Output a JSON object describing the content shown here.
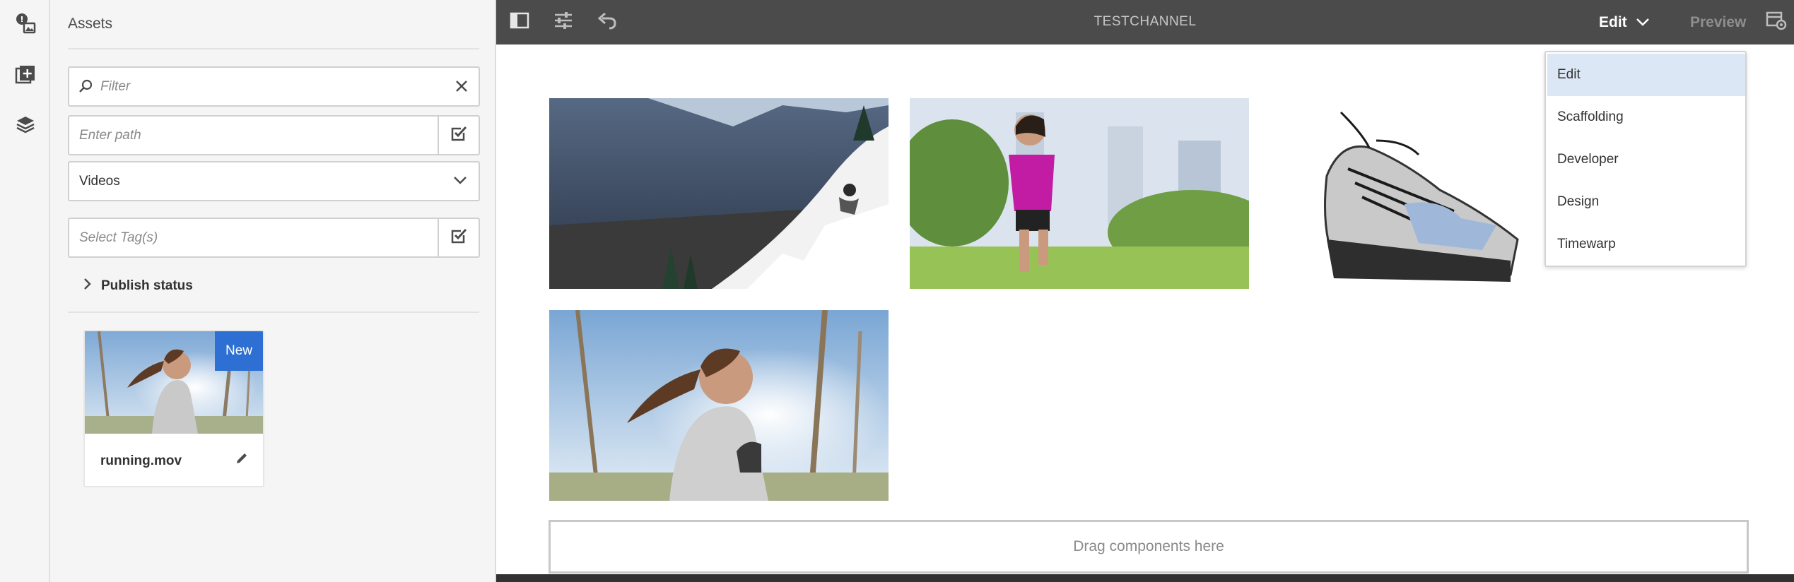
{
  "rail": {
    "items": [
      {
        "icon": "asset-finder-icon"
      },
      {
        "icon": "components-icon"
      },
      {
        "icon": "content-tree-icon"
      }
    ]
  },
  "panel": {
    "title": "Assets",
    "filter": {
      "placeholder": "Filter"
    },
    "path": {
      "placeholder": "Enter path"
    },
    "type_select": {
      "value": "Videos"
    },
    "tags": {
      "placeholder": "Select Tag(s)"
    },
    "publish_status": {
      "label": "Publish status"
    },
    "asset_card": {
      "badge": "New",
      "name": "running.mov"
    }
  },
  "toolbar": {
    "title": "TESTCHANNEL",
    "mode": "Edit",
    "preview": "Preview"
  },
  "mode_menu": {
    "items": [
      {
        "label": "Edit",
        "selected": true
      },
      {
        "label": "Scaffolding",
        "selected": false
      },
      {
        "label": "Developer",
        "selected": false
      },
      {
        "label": "Design",
        "selected": false
      },
      {
        "label": "Timewarp",
        "selected": false
      }
    ]
  },
  "canvas": {
    "images": [
      "snowboarder-image",
      "runner-in-park-image",
      "running-shoes-image",
      "jogger-closeup-image"
    ],
    "dropzone": "Drag components here"
  },
  "colors": {
    "toolbar_bg": "#4b4b4b",
    "panel_bg": "#f5f5f5",
    "badge_bg": "#2d6fd2",
    "menu_selected_bg": "#dce7f5"
  }
}
